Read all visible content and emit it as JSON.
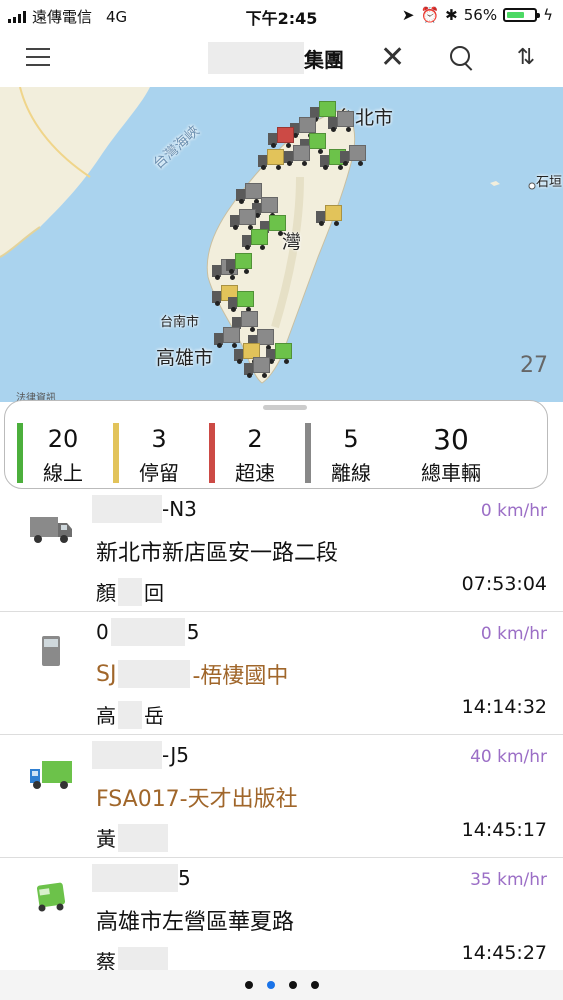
{
  "status_bar": {
    "carrier": "遠傳電信",
    "network": "4G",
    "time": "下午2:45",
    "battery": "56%"
  },
  "header": {
    "title": "集團"
  },
  "map": {
    "labels": {
      "taipei": "台北市",
      "taiwan": "灣",
      "tainan": "台南市",
      "kaohsiung": "高雄市",
      "ishigaki": "石垣",
      "strait": "台灣海峽"
    },
    "legal": "法律資訊",
    "zoom": "27"
  },
  "summary": [
    {
      "value": "20",
      "label": "線上",
      "color": "#4caf3c"
    },
    {
      "value": "3",
      "label": "停留",
      "color": "#e2c35a"
    },
    {
      "value": "2",
      "label": "超速",
      "color": "#cc4a45"
    },
    {
      "value": "5",
      "label": "離線",
      "color": "#888888"
    },
    {
      "value": "30",
      "label": "總車輛",
      "color": ""
    }
  ],
  "vehicles": [
    {
      "plate": "-N3",
      "speed": "0 km/hr",
      "address": "新北市新店區安一路二段",
      "driver_a": "顏",
      "driver_b": "回",
      "time": "07:53:04",
      "icon": "truck-gray-icon"
    },
    {
      "plate_a": "0",
      "plate_b": "5",
      "speed": "0 km/hr",
      "address_a": "SJ",
      "address_b": "-梧棲國中",
      "driver_a": "高",
      "driver_b": "岳",
      "time": "14:14:32",
      "icon": "truck-front-gray-icon"
    },
    {
      "plate": "-J5",
      "speed": "40 km/hr",
      "address": "FSA017-天才出版社",
      "driver_a": "黃",
      "time": "14:45:17",
      "icon": "truck-blue-green-icon"
    },
    {
      "plate": "5",
      "speed": "35 km/hr",
      "address": "高雄市左營區華夏路",
      "driver_a": "蔡",
      "time": "14:45:27",
      "icon": "truck-green-icon"
    }
  ],
  "pager": {
    "pages": 4,
    "active": 2
  }
}
